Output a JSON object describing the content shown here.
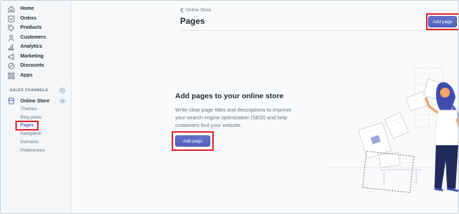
{
  "sidebar": {
    "items": [
      {
        "label": "Home",
        "icon": "home-icon"
      },
      {
        "label": "Orders",
        "icon": "orders-icon"
      },
      {
        "label": "Products",
        "icon": "tag-icon"
      },
      {
        "label": "Customers",
        "icon": "person-icon"
      },
      {
        "label": "Analytics",
        "icon": "bar-chart-icon"
      },
      {
        "label": "Marketing",
        "icon": "megaphone-icon"
      },
      {
        "label": "Discounts",
        "icon": "discount-icon"
      },
      {
        "label": "Apps",
        "icon": "apps-icon"
      }
    ],
    "section_title": "SALES CHANNELS",
    "channel": {
      "label": "Online Store",
      "icon": "store-icon"
    },
    "sub_items": [
      {
        "label": "Themes"
      },
      {
        "label": "Blog posts"
      },
      {
        "label": "Pages"
      },
      {
        "label": "Navigation"
      },
      {
        "label": "Domains"
      },
      {
        "label": "Preferences"
      }
    ],
    "active_sub_item": "Pages"
  },
  "header": {
    "breadcrumb": "Online Store",
    "title": "Pages",
    "add_button": "Add page"
  },
  "empty_state": {
    "heading": "Add pages to your online store",
    "body": "Write clear page titles and descriptions to improve your search engine optimization (SEO) and help customers find your website.",
    "button": "Add page"
  },
  "colors": {
    "primary": "#5c6ac4",
    "highlight": "#e11d2a",
    "sidebar_bg": "#f4f6f8"
  }
}
